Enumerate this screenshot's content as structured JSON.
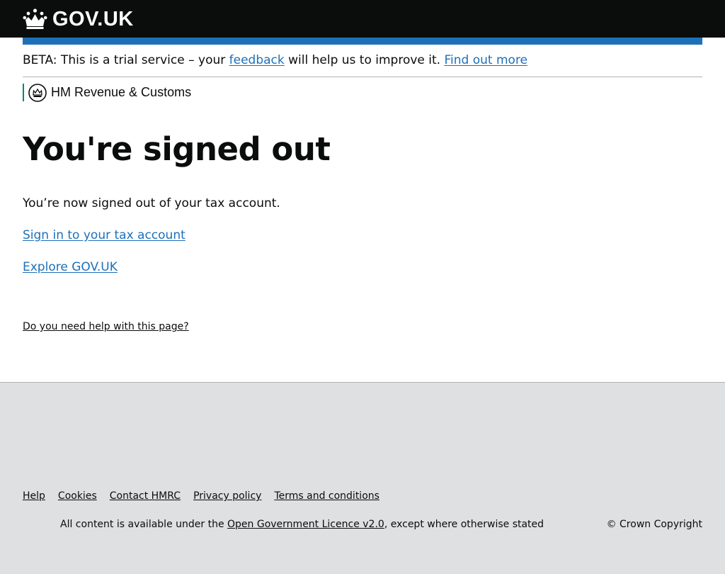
{
  "header": {
    "logo_text": "GOV.UK"
  },
  "beta_banner": {
    "prefix": "BETA: This is a trial service – your",
    "feedback_link": "feedback",
    "middle": "will help us to improve it.",
    "find_out_more_link": "Find out more"
  },
  "organisation": {
    "name": "HM Revenue & Customs"
  },
  "main": {
    "title": "You're signed out",
    "body": "You’re now signed out of your tax account.",
    "sign_in_link": "Sign in to your tax account",
    "explore_link": "Explore GOV.UK",
    "help_link": "Do you need help with this page?"
  },
  "footer": {
    "links": [
      "Help",
      "Cookies",
      "Contact HMRC",
      "Privacy policy",
      "Terms and conditions"
    ],
    "licence_prefix": "All content is available under the",
    "licence_link": "Open Government Licence v2.0",
    "licence_suffix": ", except where otherwise stated",
    "copyright": "© Crown Copyright"
  },
  "colors": {
    "header_bg": "#0b0c0c",
    "accent_blue": "#1d70b8",
    "link": "#1d70b8",
    "org_stripe": "#00857a",
    "footer_bg": "#dee0e2"
  }
}
